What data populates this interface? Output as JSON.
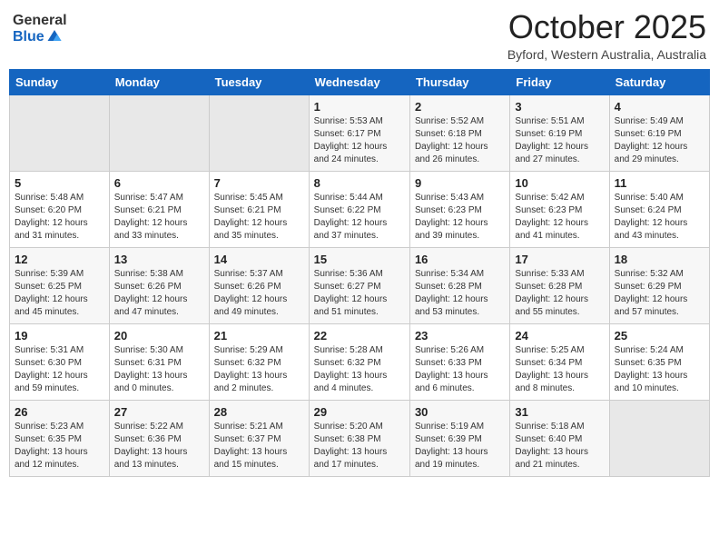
{
  "header": {
    "logo": {
      "general": "General",
      "blue": "Blue"
    },
    "title": "October 2025",
    "subtitle": "Byford, Western Australia, Australia"
  },
  "calendar": {
    "weekdays": [
      "Sunday",
      "Monday",
      "Tuesday",
      "Wednesday",
      "Thursday",
      "Friday",
      "Saturday"
    ],
    "weeks": [
      [
        {
          "day": "",
          "info": ""
        },
        {
          "day": "",
          "info": ""
        },
        {
          "day": "",
          "info": ""
        },
        {
          "day": "1",
          "info": "Sunrise: 5:53 AM\nSunset: 6:17 PM\nDaylight: 12 hours\nand 24 minutes."
        },
        {
          "day": "2",
          "info": "Sunrise: 5:52 AM\nSunset: 6:18 PM\nDaylight: 12 hours\nand 26 minutes."
        },
        {
          "day": "3",
          "info": "Sunrise: 5:51 AM\nSunset: 6:19 PM\nDaylight: 12 hours\nand 27 minutes."
        },
        {
          "day": "4",
          "info": "Sunrise: 5:49 AM\nSunset: 6:19 PM\nDaylight: 12 hours\nand 29 minutes."
        }
      ],
      [
        {
          "day": "5",
          "info": "Sunrise: 5:48 AM\nSunset: 6:20 PM\nDaylight: 12 hours\nand 31 minutes."
        },
        {
          "day": "6",
          "info": "Sunrise: 5:47 AM\nSunset: 6:21 PM\nDaylight: 12 hours\nand 33 minutes."
        },
        {
          "day": "7",
          "info": "Sunrise: 5:45 AM\nSunset: 6:21 PM\nDaylight: 12 hours\nand 35 minutes."
        },
        {
          "day": "8",
          "info": "Sunrise: 5:44 AM\nSunset: 6:22 PM\nDaylight: 12 hours\nand 37 minutes."
        },
        {
          "day": "9",
          "info": "Sunrise: 5:43 AM\nSunset: 6:23 PM\nDaylight: 12 hours\nand 39 minutes."
        },
        {
          "day": "10",
          "info": "Sunrise: 5:42 AM\nSunset: 6:23 PM\nDaylight: 12 hours\nand 41 minutes."
        },
        {
          "day": "11",
          "info": "Sunrise: 5:40 AM\nSunset: 6:24 PM\nDaylight: 12 hours\nand 43 minutes."
        }
      ],
      [
        {
          "day": "12",
          "info": "Sunrise: 5:39 AM\nSunset: 6:25 PM\nDaylight: 12 hours\nand 45 minutes."
        },
        {
          "day": "13",
          "info": "Sunrise: 5:38 AM\nSunset: 6:26 PM\nDaylight: 12 hours\nand 47 minutes."
        },
        {
          "day": "14",
          "info": "Sunrise: 5:37 AM\nSunset: 6:26 PM\nDaylight: 12 hours\nand 49 minutes."
        },
        {
          "day": "15",
          "info": "Sunrise: 5:36 AM\nSunset: 6:27 PM\nDaylight: 12 hours\nand 51 minutes."
        },
        {
          "day": "16",
          "info": "Sunrise: 5:34 AM\nSunset: 6:28 PM\nDaylight: 12 hours\nand 53 minutes."
        },
        {
          "day": "17",
          "info": "Sunrise: 5:33 AM\nSunset: 6:28 PM\nDaylight: 12 hours\nand 55 minutes."
        },
        {
          "day": "18",
          "info": "Sunrise: 5:32 AM\nSunset: 6:29 PM\nDaylight: 12 hours\nand 57 minutes."
        }
      ],
      [
        {
          "day": "19",
          "info": "Sunrise: 5:31 AM\nSunset: 6:30 PM\nDaylight: 12 hours\nand 59 minutes."
        },
        {
          "day": "20",
          "info": "Sunrise: 5:30 AM\nSunset: 6:31 PM\nDaylight: 13 hours\nand 0 minutes."
        },
        {
          "day": "21",
          "info": "Sunrise: 5:29 AM\nSunset: 6:32 PM\nDaylight: 13 hours\nand 2 minutes."
        },
        {
          "day": "22",
          "info": "Sunrise: 5:28 AM\nSunset: 6:32 PM\nDaylight: 13 hours\nand 4 minutes."
        },
        {
          "day": "23",
          "info": "Sunrise: 5:26 AM\nSunset: 6:33 PM\nDaylight: 13 hours\nand 6 minutes."
        },
        {
          "day": "24",
          "info": "Sunrise: 5:25 AM\nSunset: 6:34 PM\nDaylight: 13 hours\nand 8 minutes."
        },
        {
          "day": "25",
          "info": "Sunrise: 5:24 AM\nSunset: 6:35 PM\nDaylight: 13 hours\nand 10 minutes."
        }
      ],
      [
        {
          "day": "26",
          "info": "Sunrise: 5:23 AM\nSunset: 6:35 PM\nDaylight: 13 hours\nand 12 minutes."
        },
        {
          "day": "27",
          "info": "Sunrise: 5:22 AM\nSunset: 6:36 PM\nDaylight: 13 hours\nand 13 minutes."
        },
        {
          "day": "28",
          "info": "Sunrise: 5:21 AM\nSunset: 6:37 PM\nDaylight: 13 hours\nand 15 minutes."
        },
        {
          "day": "29",
          "info": "Sunrise: 5:20 AM\nSunset: 6:38 PM\nDaylight: 13 hours\nand 17 minutes."
        },
        {
          "day": "30",
          "info": "Sunrise: 5:19 AM\nSunset: 6:39 PM\nDaylight: 13 hours\nand 19 minutes."
        },
        {
          "day": "31",
          "info": "Sunrise: 5:18 AM\nSunset: 6:40 PM\nDaylight: 13 hours\nand 21 minutes."
        },
        {
          "day": "",
          "info": ""
        }
      ]
    ]
  }
}
